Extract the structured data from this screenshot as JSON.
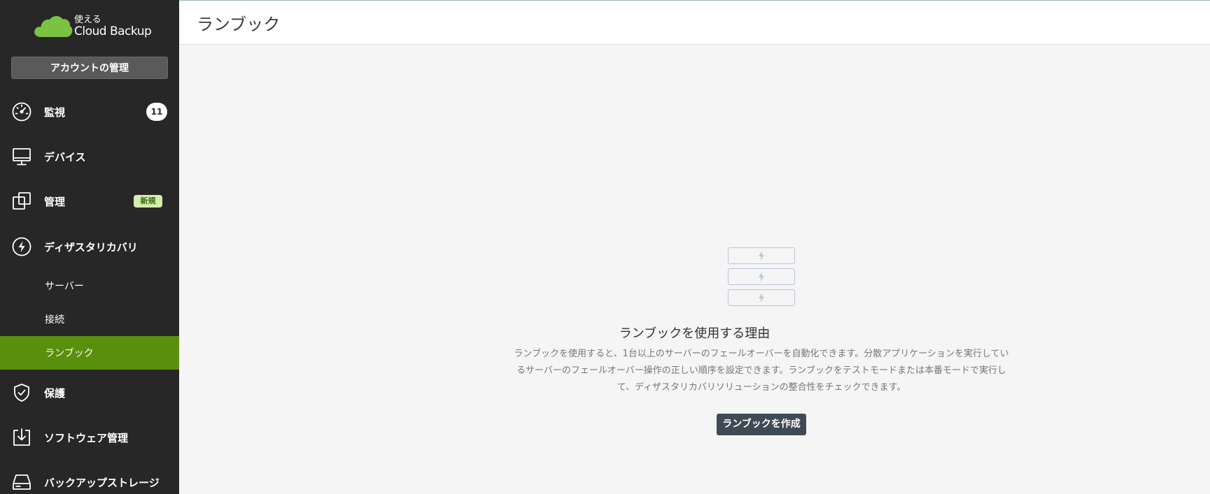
{
  "brand": {
    "logo_small": "使える",
    "logo_big": "Cloud Backup",
    "logo_color": "#7cc242"
  },
  "sidebar": {
    "account_button": "アカウントの管理",
    "items": [
      {
        "label": "監視",
        "icon": "gauge-icon",
        "badge": "11"
      },
      {
        "label": "デバイス",
        "icon": "monitor-icon"
      },
      {
        "label": "管理",
        "icon": "copy-squares-icon",
        "tag": "新規"
      },
      {
        "label": "ディザスタリカバリ",
        "icon": "lightning-circle-icon"
      },
      {
        "label": "保護",
        "icon": "shield-check-icon"
      },
      {
        "label": "ソフトウェア管理",
        "icon": "download-box-icon"
      },
      {
        "label": "バックアップストレージ",
        "icon": "drive-icon"
      }
    ],
    "sub_items": [
      {
        "label": "サーバー"
      },
      {
        "label": "接続"
      },
      {
        "label": "ランブック",
        "active": true
      }
    ],
    "active_color": "#5a8f0e"
  },
  "main": {
    "title": "ランブック",
    "empty_state": {
      "icon": "runbook-stack-icon",
      "heading": "ランブックを使用する理由",
      "description": "ランブックを使用すると、1台以上のサーバーのフェールオーバーを自動化できます。分散アプリケーションを実行しているサーバーのフェールオーバー操作の正しい順序を設定できます。ランブックをテストモードまたは本番モードで実行して、ディザスタリカバリソリューションの整合性をチェックできます。",
      "create_button": "ランブックを作成"
    }
  }
}
